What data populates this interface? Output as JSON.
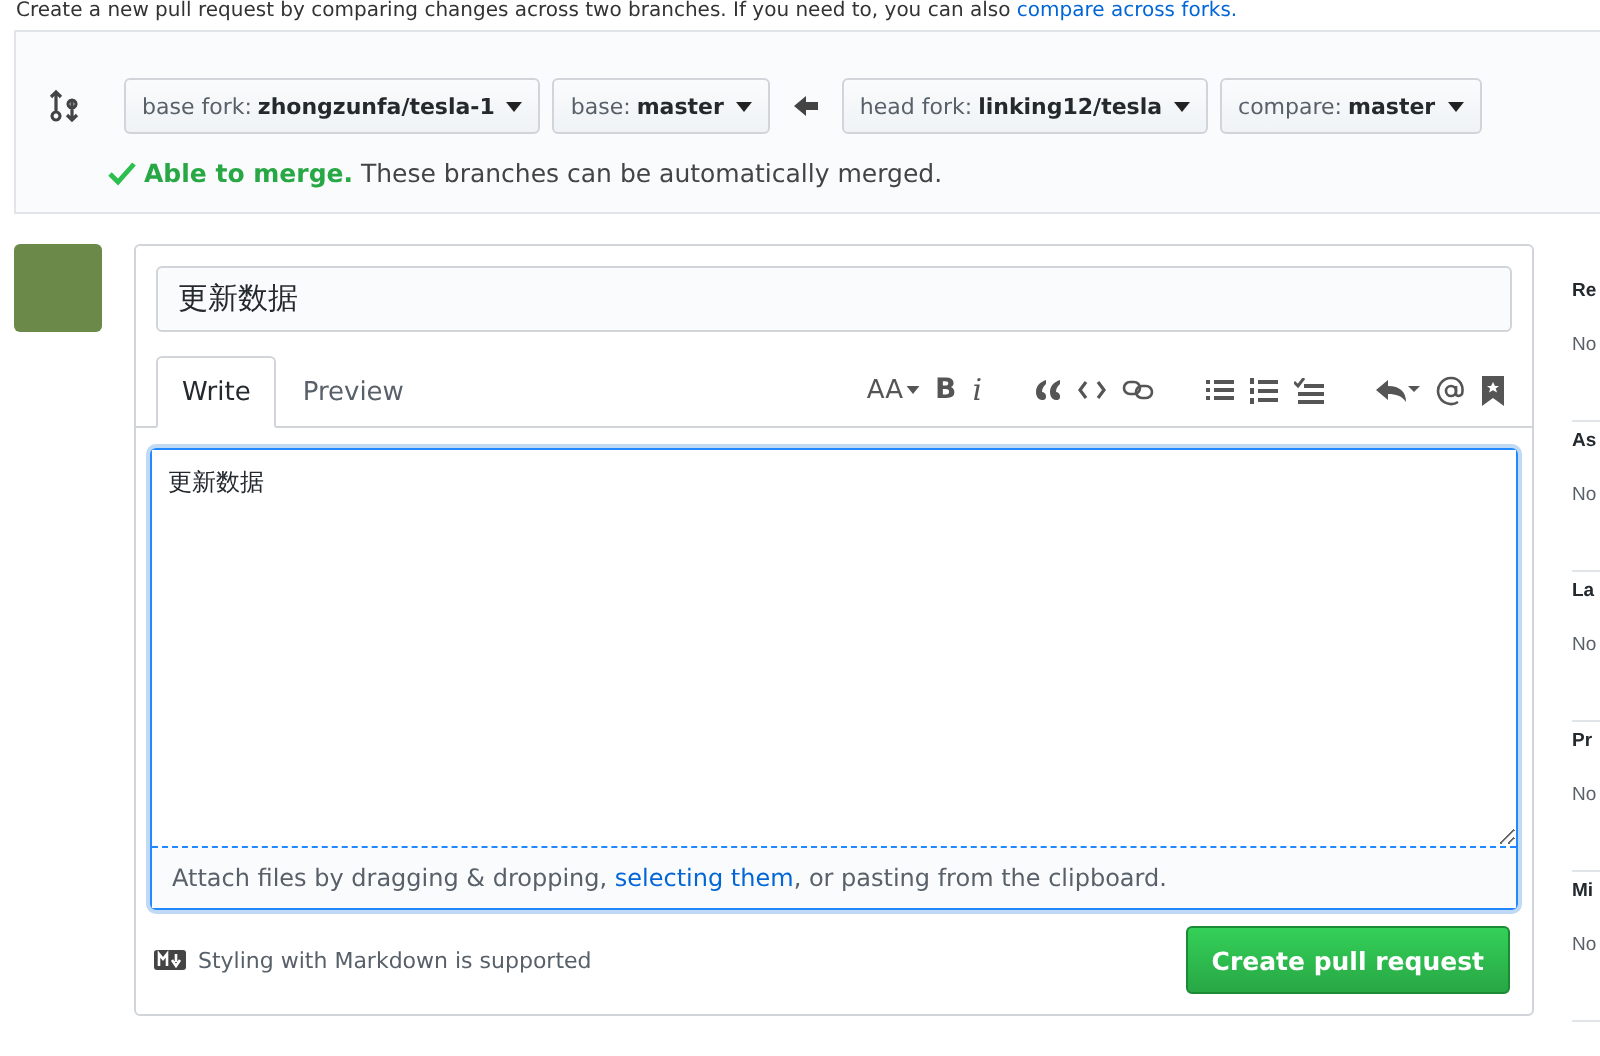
{
  "intro": {
    "text": "Create a new pull request by comparing changes across two branches. If you need to, you can also",
    "link": "compare across forks."
  },
  "compare": {
    "selectors": [
      {
        "label": "base fork:",
        "value": "zhongzunfa/tesla-1"
      },
      {
        "label": "base:",
        "value": "master"
      },
      {
        "label": "head fork:",
        "value": "linking12/tesla"
      },
      {
        "label": "compare:",
        "value": "master"
      }
    ],
    "merge_status": {
      "title": "Able to merge.",
      "text": "These branches can be automatically merged."
    }
  },
  "form": {
    "title_value": "更新数据",
    "tabs": [
      {
        "label": "Write",
        "selected": true
      },
      {
        "label": "Preview",
        "selected": false
      }
    ],
    "toolbar": [
      [
        {
          "kind": "text-size",
          "label": "AA"
        },
        {
          "kind": "bold",
          "label": "B"
        },
        {
          "kind": "italic",
          "label": "i"
        }
      ],
      [
        {
          "kind": "quote"
        },
        {
          "kind": "code"
        },
        {
          "kind": "link"
        }
      ],
      [
        {
          "kind": "bullet-list"
        },
        {
          "kind": "numbered-list"
        },
        {
          "kind": "task-list"
        }
      ],
      [
        {
          "kind": "reply"
        },
        {
          "kind": "mention"
        },
        {
          "kind": "bookmark"
        }
      ]
    ],
    "body_value": "更新数据",
    "attach": {
      "before": "Attach files by dragging & dropping, ",
      "link": "selecting them",
      "after": ", or pasting from the clipboard."
    },
    "markdown_note": "Styling with Markdown is supported",
    "submit": "Create pull request"
  },
  "sidebar": [
    {
      "heading": "Re",
      "value": "No"
    },
    {
      "heading": "As",
      "value": "No"
    },
    {
      "heading": "La",
      "value": "No"
    },
    {
      "heading": "Pr",
      "value": "No"
    },
    {
      "heading": "Mi",
      "value": "No"
    }
  ]
}
